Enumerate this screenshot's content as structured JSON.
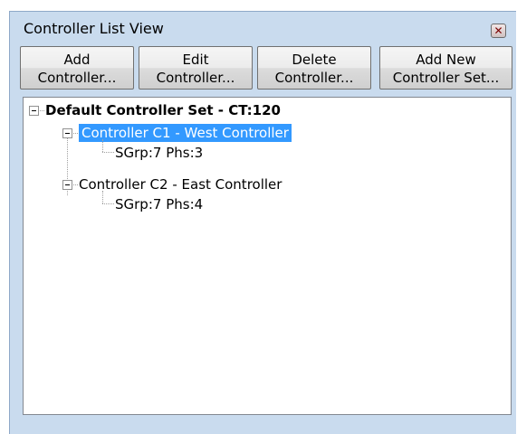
{
  "window": {
    "title": "Controller List View",
    "close_glyph": "✕"
  },
  "toolbar": {
    "add_controller": [
      "Add",
      "Controller..."
    ],
    "edit_controller": [
      "Edit",
      "Controller..."
    ],
    "delete_controller": [
      "Delete",
      "Controller..."
    ],
    "add_controller_set": [
      "Add New",
      "Controller Set..."
    ]
  },
  "tree": {
    "root_label": "Default Controller Set - CT:120",
    "children": [
      {
        "label": "Controller C1 - West Controller",
        "selected": true,
        "detail": "SGrp:7 Phs:3"
      },
      {
        "label": "Controller C2 - East Controller",
        "selected": false,
        "detail": "SGrp:7 Phs:4"
      }
    ]
  },
  "colors": {
    "selection": "#3399ff",
    "panel_bg": "#c9dbee"
  }
}
